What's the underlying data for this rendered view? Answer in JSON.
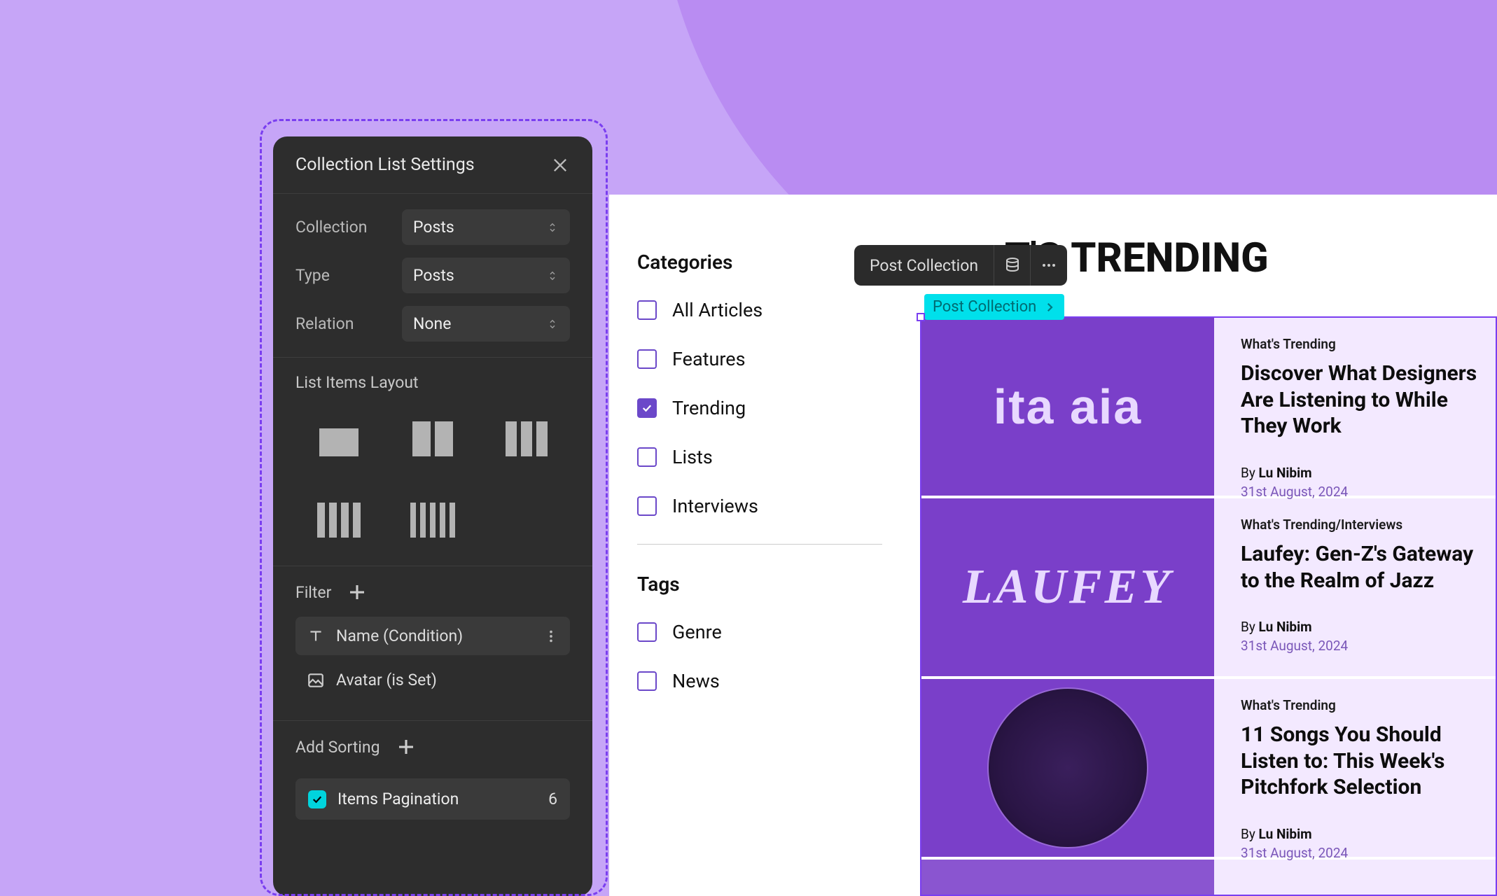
{
  "panel": {
    "title": "Collection List Settings",
    "fields": {
      "collection": {
        "label": "Collection",
        "value": "Posts"
      },
      "type": {
        "label": "Type",
        "value": "Posts"
      },
      "relation": {
        "label": "Relation",
        "value": "None"
      }
    },
    "layout_heading": "List Items Layout",
    "filter_heading": "Filter",
    "filters": [
      {
        "icon": "text",
        "label": "Name (Condition)",
        "hasMenu": true
      },
      {
        "icon": "image",
        "label": "Avatar (is Set)",
        "hasMenu": false
      }
    ],
    "sort_heading": "Add Sorting",
    "pagination": {
      "label": "Items Pagination",
      "count": "6",
      "checked": true
    }
  },
  "toolbar": {
    "label": "Post Collection"
  },
  "tag_chip": "Post Collection",
  "page_heading": "T'S TRENDING",
  "sidebar": {
    "categories_heading": "Categories",
    "categories": [
      {
        "label": "All Articles",
        "checked": false
      },
      {
        "label": "Features",
        "checked": false
      },
      {
        "label": "Trending",
        "checked": true
      },
      {
        "label": "Lists",
        "checked": false
      },
      {
        "label": "Interviews",
        "checked": false
      }
    ],
    "tags_heading": "Tags",
    "tags": [
      {
        "label": "Genre",
        "checked": false
      },
      {
        "label": "News",
        "checked": false
      }
    ]
  },
  "posts": [
    {
      "thumb_text": "ita  aia",
      "category": "What's Trending",
      "title": "Discover What Designers Are Listening to While They Work",
      "author": "Lu Nibim",
      "date": "31st August, 2024"
    },
    {
      "thumb_text": "LAUFEY",
      "category": "What's Trending/Interviews",
      "title": "Laufey: Gen-Z's Gateway to the Realm of Jazz",
      "author": "Lu Nibim",
      "date": "31st August, 2024"
    },
    {
      "thumb_text": "",
      "category": "What's Trending",
      "title": "11 Songs You Should Listen to: This Week's Pitchfork Selection",
      "author": "Lu Nibim",
      "date": "31st August, 2024"
    }
  ]
}
